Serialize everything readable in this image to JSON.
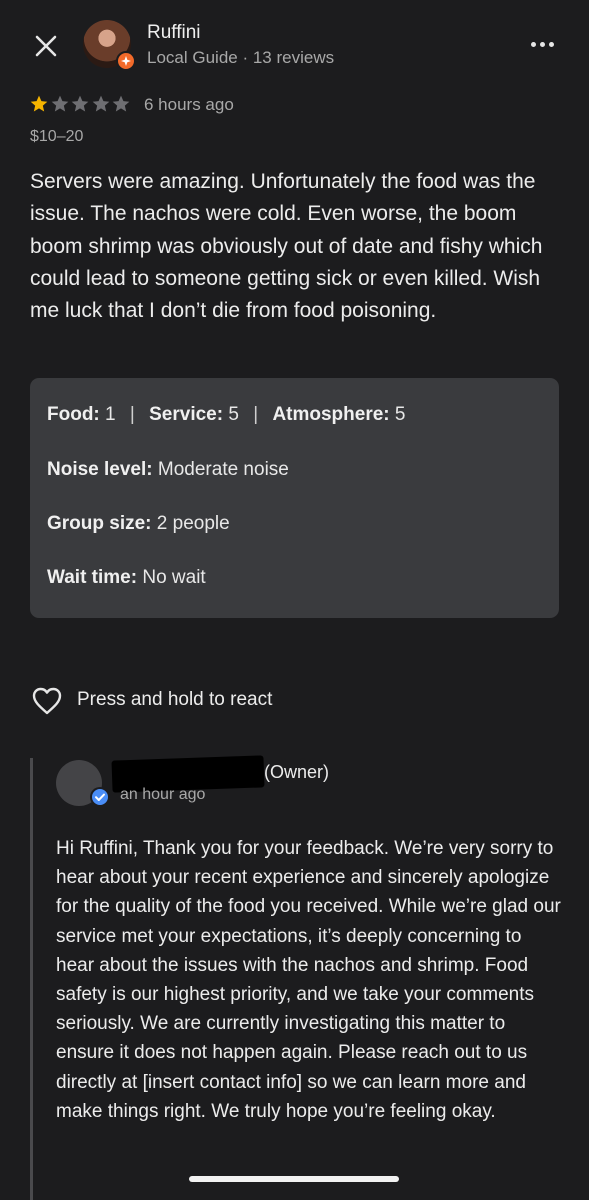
{
  "header": {
    "reviewer_name": "Ruffini",
    "reviewer_meta": "Local Guide · 13 reviews",
    "close_icon": "close-icon",
    "more_icon": "more-options-icon"
  },
  "review": {
    "rating": 1,
    "max_rating": 5,
    "time_ago": "6 hours ago",
    "price": "$10–20",
    "text": "Servers were amazing. Unfortunately the food was the issue. The nachos were cold. Even worse, the boom boom shrimp was obviously out of date and fishy which could lead to someone getting sick or even killed. Wish me luck that I don’t die from food poisoning."
  },
  "attributes": {
    "food_label": "Food:",
    "food_value": "1",
    "service_label": "Service:",
    "service_value": "5",
    "atmosphere_label": "Atmosphere:",
    "atmosphere_value": "5",
    "separator": "|",
    "noise_label": "Noise level:",
    "noise_value": "Moderate noise",
    "group_label": "Group size:",
    "group_value": "2 people",
    "wait_label": "Wait time:",
    "wait_value": "No wait"
  },
  "react": {
    "label": "Press and hold to react",
    "icon": "heart-icon"
  },
  "owner_reply": {
    "role": "(Owner)",
    "time_ago": "an hour ago",
    "text": "Hi Ruffini, Thank you for your feedback. We’re very sorry to hear about your recent experience and sincerely apologize for the quality of the food you received. While we’re glad our service met your expectations, it’s deeply concerning to hear about the issues with the nachos and shrimp. Food safety is our highest priority, and we take your comments seriously. We are currently investigating this matter to ensure it does not happen again. Please reach out to us directly at [insert contact info] so we can learn more and make things right. We truly hope you’re feeling okay."
  },
  "colors": {
    "background": "#1c1c1e",
    "star_filled": "#f5b400",
    "star_empty": "#6e6e72",
    "attr_box": "#3a3b3e",
    "local_guide_badge": "#f26a2a",
    "verified_badge": "#4a8df6"
  }
}
